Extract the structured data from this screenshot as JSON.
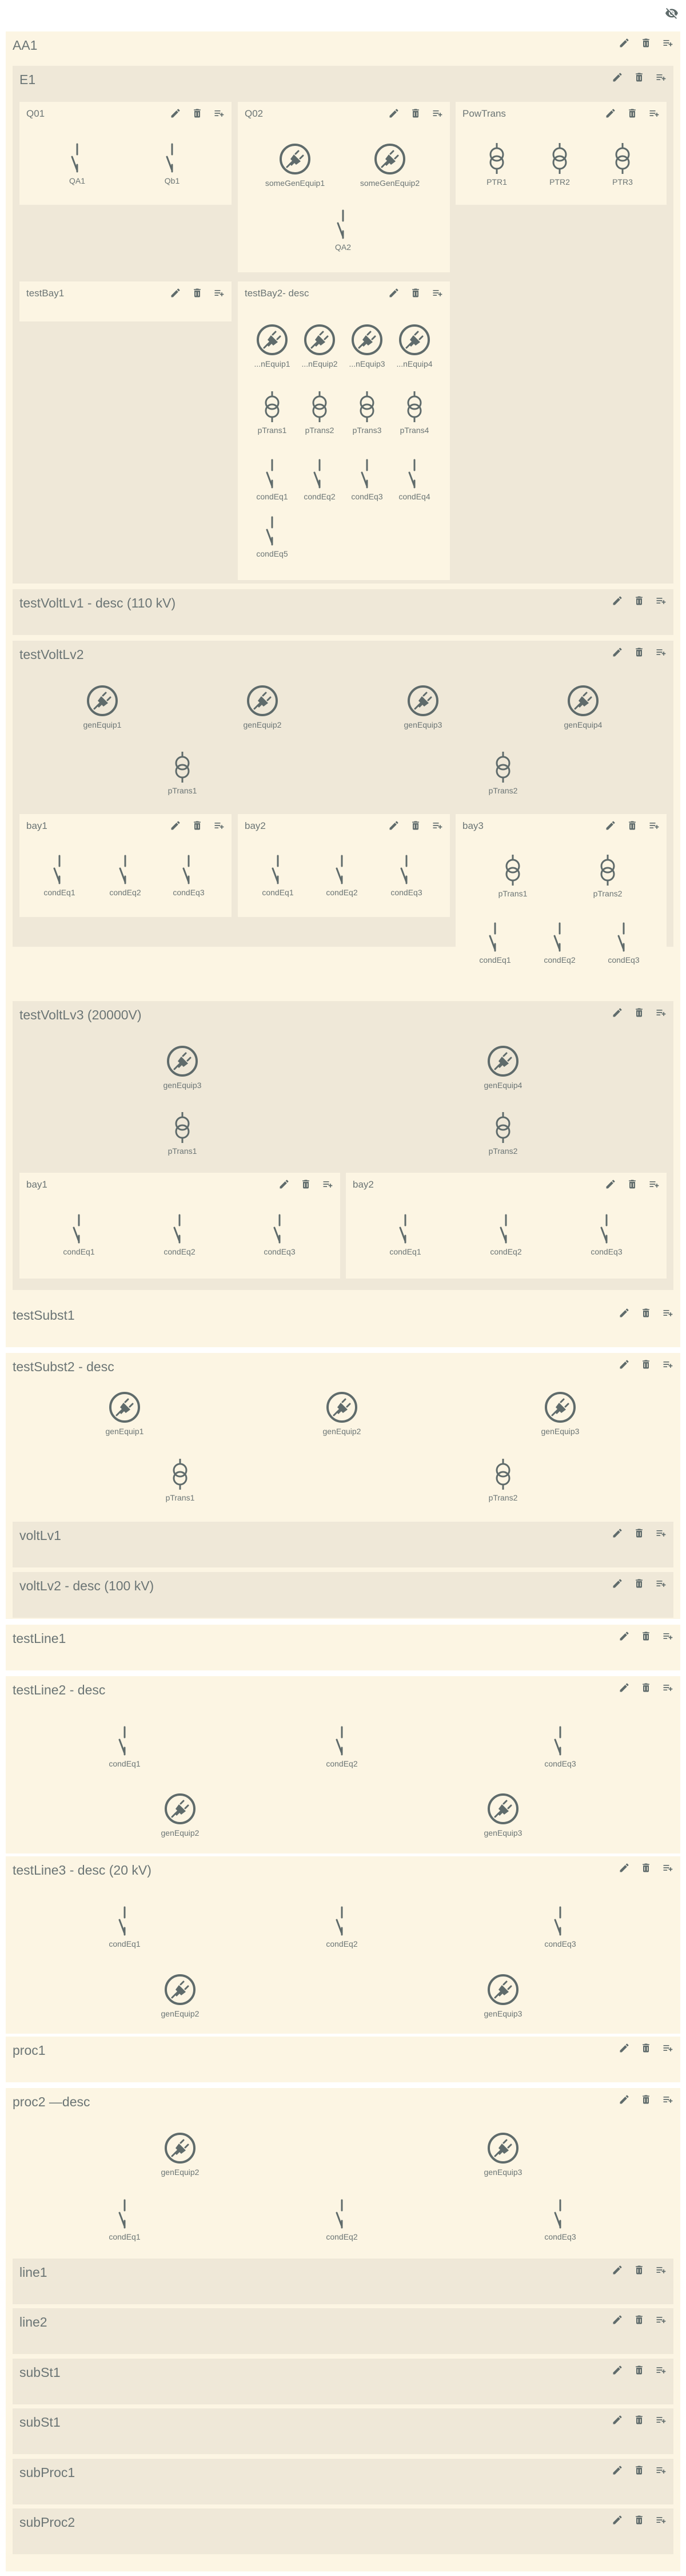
{
  "app": {
    "toggle_label": "hide equipment"
  },
  "colors": {
    "outer": "#fcf5e3",
    "inner": "#efe8d8",
    "icon": "#5f6b6b",
    "label": "#6b7575"
  },
  "actions": [
    "edit",
    "remove",
    "add"
  ],
  "containers": [
    {
      "id": "aa1",
      "title": "AA1"
    },
    {
      "id": "e1",
      "title": "E1"
    },
    {
      "id": "q01",
      "title": "Q01"
    },
    {
      "id": "q02",
      "title": "Q02"
    },
    {
      "id": "powtrans",
      "title": "PowTrans"
    },
    {
      "id": "testbay1",
      "title": "testBay1"
    },
    {
      "id": "testbay2",
      "title": "testBay2- desc"
    },
    {
      "id": "testvoltlv1",
      "title": "testVoltLv1 - desc (110 kV)"
    },
    {
      "id": "testvoltlv2",
      "title": "testVoltLv2"
    },
    {
      "id": "lv2bay1",
      "title": "bay1"
    },
    {
      "id": "lv2bay2",
      "title": "bay2"
    },
    {
      "id": "lv2bay3",
      "title": "bay3"
    },
    {
      "id": "testvoltlv3",
      "title": "testVoltLv3 (20000V)"
    },
    {
      "id": "lv3bay1",
      "title": "bay1"
    },
    {
      "id": "lv3bay2",
      "title": "bay2"
    },
    {
      "id": "testsubst1",
      "title": "testSubst1"
    },
    {
      "id": "testsubst2",
      "title": "testSubst2 - desc"
    },
    {
      "id": "voltlv1",
      "title": "voltLv1"
    },
    {
      "id": "voltlv2",
      "title": "voltLv2 - desc (100 kV)"
    },
    {
      "id": "testline1",
      "title": "testLine1"
    },
    {
      "id": "testline2",
      "title": "testLine2 - desc"
    },
    {
      "id": "testline3",
      "title": "testLine3 - desc (20 kV)"
    },
    {
      "id": "proc1",
      "title": "proc1"
    },
    {
      "id": "proc2",
      "title": "proc2 —desc"
    },
    {
      "id": "line1",
      "title": "line1"
    },
    {
      "id": "line2",
      "title": "line2"
    },
    {
      "id": "subst1a",
      "title": "subSt1"
    },
    {
      "id": "subst1b",
      "title": "subSt1"
    },
    {
      "id": "subproc1",
      "title": "subProc1"
    },
    {
      "id": "subproc2",
      "title": "subProc2"
    }
  ],
  "equipment": [
    {
      "id": "eq1",
      "label": "QA1",
      "kind": "switch"
    },
    {
      "id": "eq2",
      "label": "Qb1",
      "kind": "switch"
    },
    {
      "id": "eq3",
      "label": "someGenEquip1",
      "kind": "generator"
    },
    {
      "id": "eq4",
      "label": "someGenEquip2",
      "kind": "generator"
    },
    {
      "id": "eq5",
      "label": "QA2",
      "kind": "switch"
    },
    {
      "id": "eq6",
      "label": "PTR1",
      "kind": "transformer"
    },
    {
      "id": "eq7",
      "label": "PTR2",
      "kind": "transformer"
    },
    {
      "id": "eq8",
      "label": "PTR3",
      "kind": "transformer"
    },
    {
      "id": "eq9",
      "label": "...nEquip1",
      "kind": "generator"
    },
    {
      "id": "eq10",
      "label": "...nEquip2",
      "kind": "generator"
    },
    {
      "id": "eq11",
      "label": "...nEquip3",
      "kind": "generator"
    },
    {
      "id": "eq12",
      "label": "...nEquip4",
      "kind": "generator"
    },
    {
      "id": "eq13",
      "label": "pTrans1",
      "kind": "transformer"
    },
    {
      "id": "eq14",
      "label": "pTrans2",
      "kind": "transformer"
    },
    {
      "id": "eq15",
      "label": "pTrans3",
      "kind": "transformer"
    },
    {
      "id": "eq16",
      "label": "pTrans4",
      "kind": "transformer"
    },
    {
      "id": "eq17",
      "label": "condEq1",
      "kind": "switch"
    },
    {
      "id": "eq18",
      "label": "condEq2",
      "kind": "switch"
    },
    {
      "id": "eq19",
      "label": "condEq3",
      "kind": "switch"
    },
    {
      "id": "eq20",
      "label": "condEq4",
      "kind": "switch"
    },
    {
      "id": "eq21",
      "label": "condEq5",
      "kind": "switch"
    },
    {
      "id": "eq22",
      "label": "genEquip1",
      "kind": "generator"
    },
    {
      "id": "eq23",
      "label": "genEquip2",
      "kind": "generator"
    },
    {
      "id": "eq24",
      "label": "genEquip3",
      "kind": "generator"
    },
    {
      "id": "eq25",
      "label": "genEquip4",
      "kind": "generator"
    },
    {
      "id": "eq26",
      "label": "pTrans1",
      "kind": "transformer"
    },
    {
      "id": "eq27",
      "label": "pTrans2",
      "kind": "transformer"
    },
    {
      "id": "eq28",
      "label": "condEq1",
      "kind": "switch"
    },
    {
      "id": "eq29",
      "label": "condEq2",
      "kind": "switch"
    },
    {
      "id": "eq30",
      "label": "condEq3",
      "kind": "switch"
    },
    {
      "id": "eq31",
      "label": "condEq1",
      "kind": "switch"
    },
    {
      "id": "eq32",
      "label": "condEq2",
      "kind": "switch"
    },
    {
      "id": "eq33",
      "label": "condEq3",
      "kind": "switch"
    },
    {
      "id": "eq34",
      "label": "pTrans1",
      "kind": "transformer"
    },
    {
      "id": "eq35",
      "label": "pTrans2",
      "kind": "transformer"
    },
    {
      "id": "eq36",
      "label": "condEq1",
      "kind": "switch"
    },
    {
      "id": "eq37",
      "label": "condEq2",
      "kind": "switch"
    },
    {
      "id": "eq38",
      "label": "condEq3",
      "kind": "switch"
    },
    {
      "id": "eq39",
      "label": "genEquip3",
      "kind": "generator"
    },
    {
      "id": "eq40",
      "label": "genEquip4",
      "kind": "generator"
    },
    {
      "id": "eq41",
      "label": "pTrans1",
      "kind": "transformer"
    },
    {
      "id": "eq42",
      "label": "pTrans2",
      "kind": "transformer"
    },
    {
      "id": "eq43",
      "label": "condEq1",
      "kind": "switch"
    },
    {
      "id": "eq44",
      "label": "condEq2",
      "kind": "switch"
    },
    {
      "id": "eq45",
      "label": "condEq3",
      "kind": "switch"
    },
    {
      "id": "eq46",
      "label": "condEq1",
      "kind": "switch"
    },
    {
      "id": "eq47",
      "label": "condEq2",
      "kind": "switch"
    },
    {
      "id": "eq48",
      "label": "condEq3",
      "kind": "switch"
    },
    {
      "id": "eq49",
      "label": "genEquip1",
      "kind": "generator"
    },
    {
      "id": "eq50",
      "label": "genEquip2",
      "kind": "generator"
    },
    {
      "id": "eq51",
      "label": "genEquip3",
      "kind": "generator"
    },
    {
      "id": "eq52",
      "label": "pTrans1",
      "kind": "transformer"
    },
    {
      "id": "eq53",
      "label": "pTrans2",
      "kind": "transformer"
    },
    {
      "id": "eq54",
      "label": "condEq1",
      "kind": "switch"
    },
    {
      "id": "eq55",
      "label": "condEq2",
      "kind": "switch"
    },
    {
      "id": "eq56",
      "label": "condEq3",
      "kind": "switch"
    },
    {
      "id": "eq57",
      "label": "genEquip2",
      "kind": "generator"
    },
    {
      "id": "eq58",
      "label": "genEquip3",
      "kind": "generator"
    },
    {
      "id": "eq59",
      "label": "condEq1",
      "kind": "switch"
    },
    {
      "id": "eq60",
      "label": "condEq2",
      "kind": "switch"
    },
    {
      "id": "eq61",
      "label": "condEq3",
      "kind": "switch"
    },
    {
      "id": "eq62",
      "label": "genEquip2",
      "kind": "generator"
    },
    {
      "id": "eq63",
      "label": "genEquip3",
      "kind": "generator"
    },
    {
      "id": "eq64",
      "label": "genEquip2",
      "kind": "generator"
    },
    {
      "id": "eq65",
      "label": "genEquip3",
      "kind": "generator"
    },
    {
      "id": "eq66",
      "label": "condEq1",
      "kind": "switch"
    },
    {
      "id": "eq67",
      "label": "condEq2",
      "kind": "switch"
    },
    {
      "id": "eq68",
      "label": "condEq3",
      "kind": "switch"
    }
  ]
}
